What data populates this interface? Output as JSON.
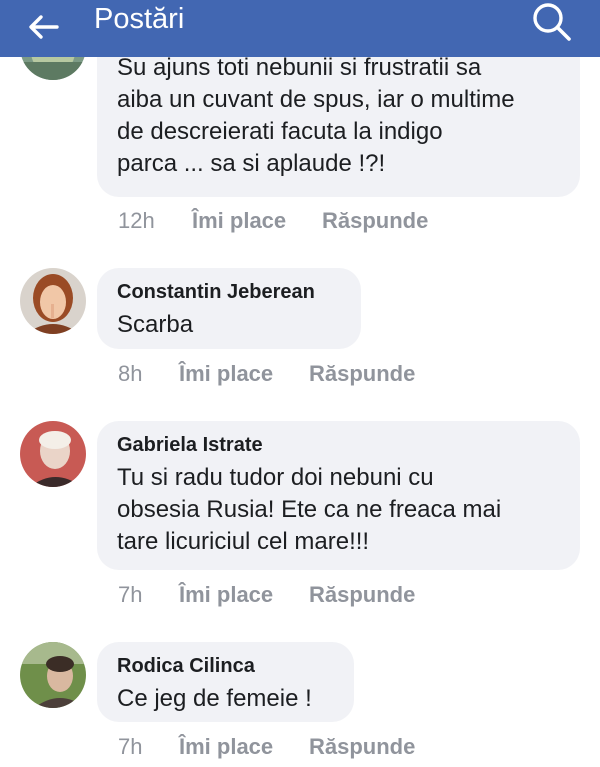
{
  "header": {
    "title": "Postări",
    "back_icon": "arrow-left-icon",
    "search_icon": "search-icon",
    "bg_color": "#4267b2"
  },
  "actions": {
    "like_label": "Îmi place",
    "reply_label": "Răspunde"
  },
  "comments": [
    {
      "author": "",
      "text": "Su ajuns toti nebunii si frustratii sa\naiba un cuvant de spus, iar o multime\nde descreierati facuta la indigo\nparca ... sa si aplaude !?!",
      "time": "12h"
    },
    {
      "author": "Constantin Jeberean",
      "text": "Scarba",
      "time": "8h"
    },
    {
      "author": "Gabriela Istrate",
      "text": "Tu si radu tudor doi nebuni cu\nobsesia Rusia! Ete ca ne freaca mai\ntare licuriciul cel mare!!!",
      "time": "7h"
    },
    {
      "author": "Rodica Cilinca",
      "text": "Ce jeg de femeie !",
      "time": "7h"
    }
  ]
}
